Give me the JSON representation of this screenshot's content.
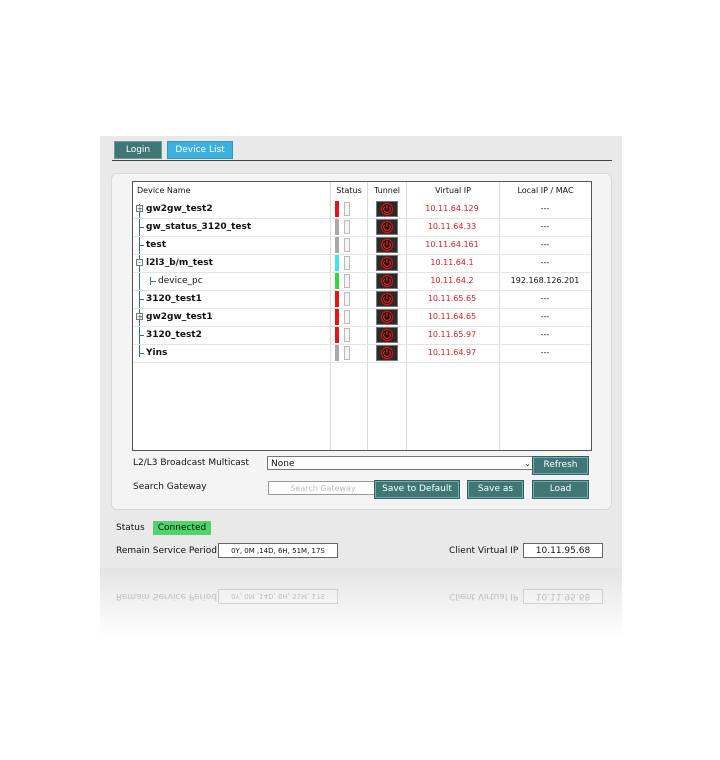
{
  "tabs": {
    "login": "Login",
    "device_list": "Device List"
  },
  "table": {
    "headers": {
      "name": "Device Name",
      "status": "Status",
      "tunnel": "Tunnel",
      "vip": "Virtual IP",
      "lip": "Local IP / MAC"
    },
    "rows": [
      {
        "name": "gw2gw_test2",
        "expander": "+",
        "status_color": "#e51515",
        "vip": "10.11.64.129",
        "lip": "---"
      },
      {
        "name": "gw_status_3120_test",
        "expander": "",
        "status_color": "#a8a8a8",
        "vip": "10.11.64.33",
        "lip": "---"
      },
      {
        "name": "test",
        "expander": "",
        "status_color": "#a8a8a8",
        "vip": "10.11.64.161",
        "lip": "---"
      },
      {
        "name": "l2l3_b/m_test",
        "expander": "-",
        "status_color": "#3fe3ea",
        "vip": "10.11.64.1",
        "lip": "---"
      },
      {
        "name": "device_pc",
        "expander": "",
        "status_color": "#35d637",
        "vip": "10.11.64.2",
        "lip": "192.168.126.201"
      },
      {
        "name": "3120_test1",
        "expander": "",
        "status_color": "#e51515",
        "vip": "10.11.65.65",
        "lip": "---"
      },
      {
        "name": "gw2gw_test1",
        "expander": "+",
        "status_color": "#e51515",
        "vip": "10.11.64.65",
        "lip": "---"
      },
      {
        "name": "3120_test2",
        "expander": "",
        "status_color": "#e51515",
        "vip": "10.11.65.97",
        "lip": "---"
      },
      {
        "name": "Yins",
        "expander": "",
        "status_color": "#a8a8a8",
        "vip": "10.11.64.97",
        "lip": "---"
      }
    ]
  },
  "controls": {
    "multicast_label": "L2/L3 Broadcast Multicast",
    "multicast_value": "None",
    "refresh": "Refresh",
    "search_label": "Search Gateway",
    "search_placeholder": "Search Gateway",
    "save_default": "Save to Default",
    "save_as": "Save as",
    "load": "Load"
  },
  "footer": {
    "status_label": "Status",
    "status_value": "Connected",
    "remain_label": "Remain Service Period",
    "remain_value": "0Y, 0M ,14D, 6H, 51M, 17S",
    "client_vip_label": "Client Virtual IP",
    "client_vip_value": "10.11.95.68"
  },
  "colors": {
    "tab_login": "#3f7777",
    "tab_device": "#3cb0de",
    "button": "#3f7777",
    "connected": "#4fd36a",
    "vip_text": "#e01818"
  }
}
